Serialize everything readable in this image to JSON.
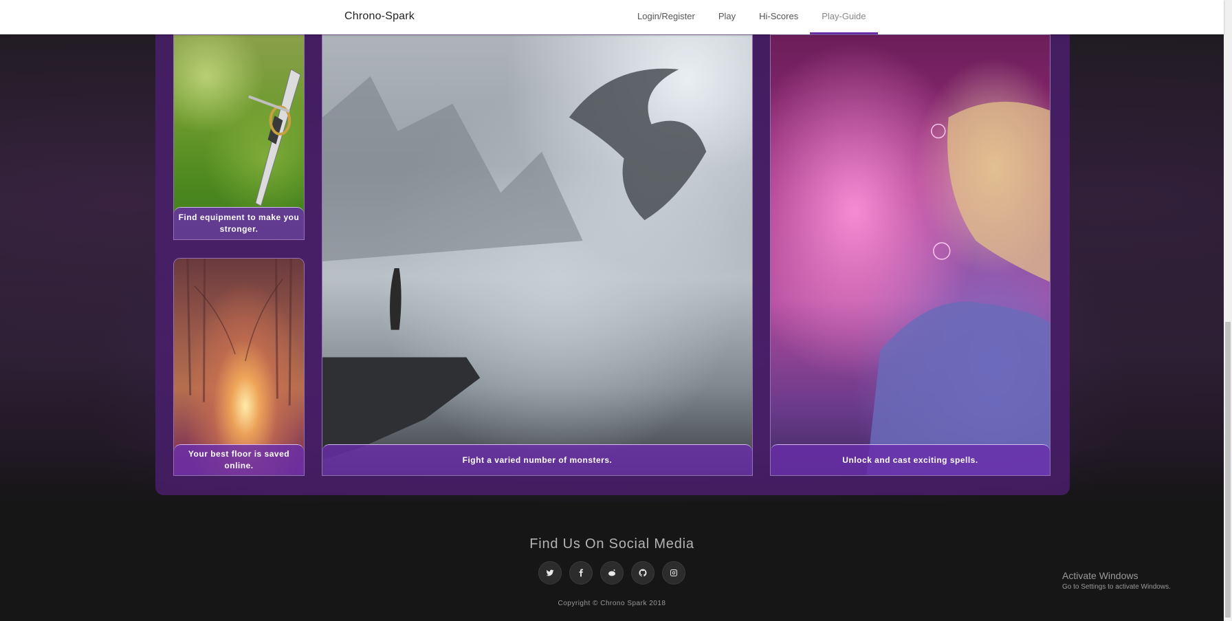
{
  "navbar": {
    "brand": "Chrono-Spark",
    "links": [
      {
        "label": "Login/Register"
      },
      {
        "label": "Play"
      },
      {
        "label": "Hi-Scores"
      },
      {
        "label": "Play-Guide",
        "active": true
      }
    ]
  },
  "cards": [
    {
      "caption": "Find equipment to make you stronger.",
      "image": "sword-on-grass-image"
    },
    {
      "caption": "Your best floor is saved online.",
      "image": "forest-path-image"
    },
    {
      "caption": "Fight a varied number of monsters.",
      "image": "dragon-mountain-image"
    },
    {
      "caption": "Unlock and cast exciting spells.",
      "image": "spell-caster-image"
    }
  ],
  "footer": {
    "title": "Find Us On Social Media",
    "social": [
      "twitter-icon",
      "facebook-icon",
      "reddit-icon",
      "github-icon",
      "instagram-icon"
    ],
    "copyright": "Copyright © Chrono Spark 2018"
  },
  "windows_watermark": {
    "title": "Activate Windows",
    "subtitle": "Go to Settings to activate Windows."
  },
  "colors": {
    "accent": "#6b2fa5",
    "frame": "#4b1e6e",
    "caption_bg": "#692daa"
  }
}
